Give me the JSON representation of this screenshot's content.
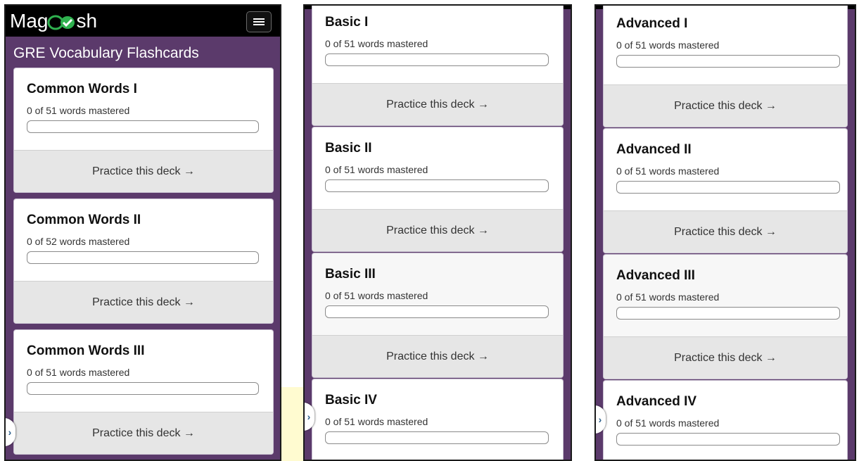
{
  "app": {
    "logo_text_start": "Mag",
    "logo_text_end": "sh",
    "page_title": "GRE Vocabulary Flashcards",
    "menu_icon": "hamburger-menu-icon",
    "expand_icon": "chevron-right-icon",
    "colors": {
      "brand_purple": "#5b3a6b",
      "topbar": "#000000",
      "logo_check": "#2fb14f",
      "action_bg": "#e6e6e6"
    }
  },
  "action_label": "Practice this deck →",
  "side_tab_glyph": "›",
  "screens": [
    {
      "decks": [
        {
          "title": "Common Words I",
          "count_text": "0 of 51 words mastered",
          "progress": 0,
          "action": "Practice this deck →"
        },
        {
          "title": "Common Words II",
          "count_text": "0 of 52 words mastered",
          "progress": 0,
          "action": "Practice this deck →"
        },
        {
          "title": "Common Words III",
          "count_text": "0 of 51 words mastered",
          "progress": 0,
          "action": "Practice this deck →"
        }
      ]
    },
    {
      "decks": [
        {
          "title": "Basic I",
          "count_text": "0 of 51 words mastered",
          "progress": 0,
          "action": "Practice this deck →"
        },
        {
          "title": "Basic II",
          "count_text": "0 of 51 words mastered",
          "progress": 0,
          "action": "Practice this deck →"
        },
        {
          "title": "Basic III",
          "count_text": "0 of 51 words mastered",
          "progress": 0,
          "action": "Practice this deck →"
        },
        {
          "title": "Basic IV",
          "count_text": "0 of 51 words mastered",
          "progress": 0
        }
      ]
    },
    {
      "decks": [
        {
          "title": "Advanced I",
          "count_text": "0 of 51 words mastered",
          "progress": 0,
          "action": "Practice this deck →"
        },
        {
          "title": "Advanced II",
          "count_text": "0 of 51 words mastered",
          "progress": 0,
          "action": "Practice this deck →"
        },
        {
          "title": "Advanced III",
          "count_text": "0 of 51 words mastered",
          "progress": 0,
          "action": "Practice this deck →"
        },
        {
          "title": "Advanced IV",
          "count_text": "0 of 51 words mastered",
          "progress": 0
        }
      ]
    }
  ]
}
